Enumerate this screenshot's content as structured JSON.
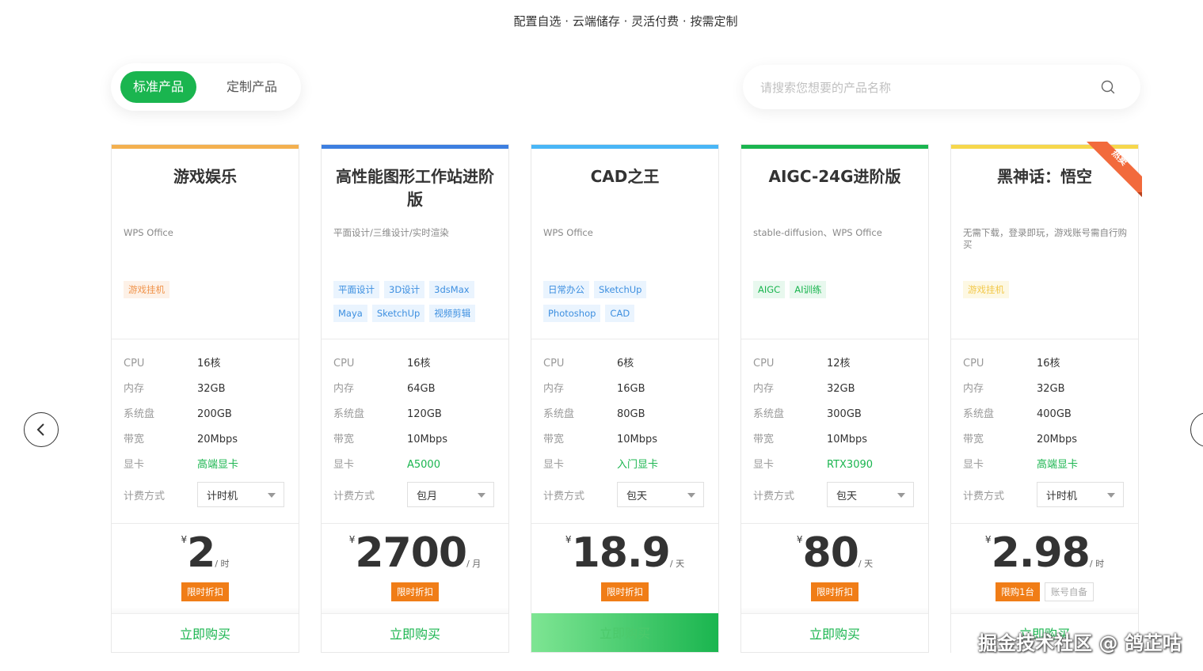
{
  "header": {
    "subtitle": "配置自选 · 云端储存 · 灵活付费 · 按需定制"
  },
  "tabs": [
    {
      "label": "标准产品",
      "active": true
    },
    {
      "label": "定制产品",
      "active": false
    }
  ],
  "search": {
    "placeholder": "请搜索您想要的产品名称"
  },
  "spec_labels": {
    "cpu": "CPU",
    "memory": "内存",
    "disk": "系统盘",
    "bandwidth": "带宽",
    "gpu": "显卡",
    "billing": "计费方式"
  },
  "colors": {
    "brand": "#1ab54f",
    "discount": "#f07d17"
  },
  "cards": [
    {
      "title": "游戏娱乐",
      "accent": "#f3b04f",
      "desc": "WPS Office",
      "tags": [
        {
          "label": "游戏挂机",
          "style": "orange"
        }
      ],
      "cpu": "16核",
      "memory": "32GB",
      "disk": "200GB",
      "bandwidth": "20Mbps",
      "gpu": "高端显卡",
      "billing": "计时机",
      "currency": "¥",
      "price": "2",
      "unit": "/ 时",
      "badges": [
        {
          "label": "限时折扣",
          "style": "orange"
        }
      ],
      "buy_label": "立即购买"
    },
    {
      "title": "高性能图形工作站进阶版",
      "accent": "#3d7fe0",
      "desc": "平面设计/三维设计/实时渲染",
      "tags": [
        {
          "label": "平面设计",
          "style": "blue"
        },
        {
          "label": "3D设计",
          "style": "blue"
        },
        {
          "label": "3dsMax",
          "style": "blue"
        },
        {
          "label": "Maya",
          "style": "blue"
        },
        {
          "label": "SketchUp",
          "style": "blue"
        },
        {
          "label": "视频剪辑",
          "style": "blue"
        }
      ],
      "cpu": "16核",
      "memory": "64GB",
      "disk": "120GB",
      "bandwidth": "10Mbps",
      "gpu": "A5000",
      "billing": "包月",
      "currency": "¥",
      "price": "2700",
      "unit": "/ 月",
      "badges": [
        {
          "label": "限时折扣",
          "style": "orange"
        }
      ],
      "buy_label": "立即购买"
    },
    {
      "title": "CAD之王",
      "accent": "#49b6f6",
      "desc": "WPS Office",
      "tags": [
        {
          "label": "日常办公",
          "style": "blue"
        },
        {
          "label": "SketchUp",
          "style": "blue"
        },
        {
          "label": "Photoshop",
          "style": "blue"
        },
        {
          "label": "CAD",
          "style": "blue"
        }
      ],
      "cpu": "6核",
      "memory": "16GB",
      "disk": "80GB",
      "bandwidth": "10Mbps",
      "gpu": "入门显卡",
      "billing": "包天",
      "currency": "¥",
      "price": "18.9",
      "unit": "/ 天",
      "badges": [
        {
          "label": "限时折扣",
          "style": "orange"
        }
      ],
      "buy_label": "立即购买"
    },
    {
      "title": "AIGC-24G进阶版",
      "accent": "#1ab54f",
      "desc": "stable-diffusion、WPS Office",
      "tags": [
        {
          "label": "AIGC",
          "style": "green"
        },
        {
          "label": "AI训练",
          "style": "green"
        }
      ],
      "cpu": "12核",
      "memory": "32GB",
      "disk": "300GB",
      "bandwidth": "10Mbps",
      "gpu": "RTX3090",
      "billing": "包天",
      "currency": "¥",
      "price": "80",
      "unit": "/ 天",
      "badges": [
        {
          "label": "限时折扣",
          "style": "orange"
        }
      ],
      "buy_label": "立即购买"
    },
    {
      "title": "黑神话：悟空",
      "accent": "#f6d74c",
      "desc": "无需下载，登录即玩，游戏账号需自行购买",
      "tags": [
        {
          "label": "游戏挂机",
          "style": "yellow"
        }
      ],
      "cpu": "16核",
      "memory": "32GB",
      "disk": "400GB",
      "bandwidth": "20Mbps",
      "gpu": "高端显卡",
      "billing": "计时机",
      "currency": "¥",
      "price": "2.98",
      "unit": "/ 时",
      "badges": [
        {
          "label": "限购1台",
          "style": "orange"
        },
        {
          "label": "账号自备",
          "style": "gray"
        }
      ],
      "buy_label": "立即购买",
      "ribbon": "热卖"
    }
  ],
  "watermark": "掘金技术社区 @ 鸽芷咕"
}
